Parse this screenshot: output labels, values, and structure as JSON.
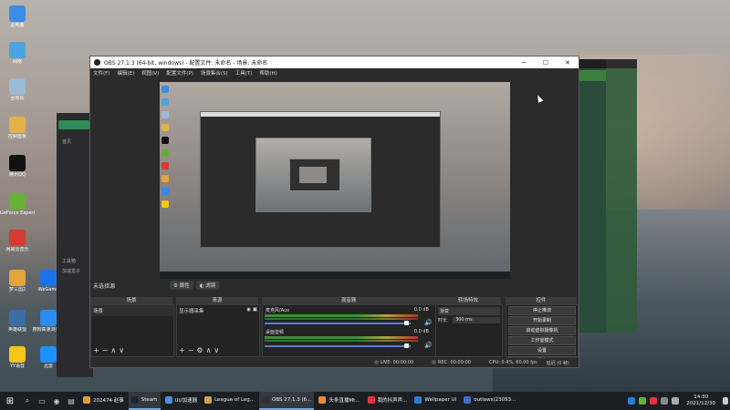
{
  "desktop": {
    "icons": [
      {
        "label": "此电脑",
        "color": "#3a8ee6"
      },
      {
        "label": "网络",
        "color": "#4aa3df"
      },
      {
        "label": "回收站",
        "color": "#9bbbd6"
      },
      {
        "label": "控制面板",
        "color": "#e0b34a"
      },
      {
        "label": "腾讯QQ",
        "color": "#111111"
      },
      {
        "label": "GeForce Experience",
        "color": "#66b032"
      },
      {
        "label": "网易云音乐",
        "color": "#d43c33"
      },
      {
        "label": "梦三国2",
        "color": "#e2a53c"
      },
      {
        "label": "WeGame",
        "color": "#1a73e8"
      },
      {
        "label": "英雄联盟",
        "color": "#3a6ea5"
      },
      {
        "label": "搜狗高速浏览器",
        "color": "#2d8cf0"
      },
      {
        "label": "YY语音",
        "color": "#f5c518"
      },
      {
        "label": "迅雷",
        "color": "#1e90ff"
      }
    ],
    "behind_app_labels": [
      "首页",
      "工具箱",
      "加速盒子"
    ]
  },
  "obs": {
    "title": "OBS 27.1.3 (64-bit, windows) - 配置文件: 未命名 - 场景: 未命名",
    "menu": [
      "文件(F)",
      "编辑(E)",
      "视图(V)",
      "配置文件(P)",
      "场景集合(S)",
      "工具(T)",
      "帮助(H)"
    ],
    "window_buttons": [
      "─",
      "☐",
      "✕"
    ],
    "source_bar": {
      "label": "未选择源",
      "props": "属性",
      "filters": "滤镜"
    },
    "panels": {
      "scenes": {
        "title": "场景",
        "items": [
          "场景"
        ]
      },
      "sources": {
        "title": "来源",
        "items": [
          "显示器采集"
        ]
      },
      "mixer": {
        "title": "混音器",
        "tracks": [
          {
            "name": "麦克风/Aux",
            "db": "0.0 dB"
          },
          {
            "name": "桌面音频",
            "db": "0.0 dB"
          }
        ]
      },
      "transitions": {
        "title": "转场特效",
        "type": "渐变",
        "duration_label": "时长",
        "duration": "300 ms"
      },
      "controls": {
        "title": "控件",
        "buttons": [
          "停止推流",
          "开始录制",
          "启动虚拟摄像机",
          "工作室模式",
          "设置",
          "退出"
        ]
      }
    },
    "statusbar": {
      "live": "LIVE: 00:00:00",
      "rec": "REC: 00:00:00",
      "cpu": "CPU: 0.4%, 60.00 fps",
      "msg": "延迟 (0 帧)"
    }
  },
  "taskbar": {
    "tasks": [
      {
        "label": "202474·赵事",
        "color": "#e0a030",
        "active": false
      },
      {
        "label": "Steam",
        "color": "#1b2838",
        "active": true
      },
      {
        "label": "UU加速器",
        "color": "#4a90e2",
        "active": false
      },
      {
        "label": "League of Leg...",
        "color": "#c8a545",
        "active": false
      },
      {
        "label": "OBS 27.1.3 (6...",
        "color": "#333333",
        "active": true
      },
      {
        "label": "头条直播Mt...",
        "color": "#f08a2d",
        "active": false
      },
      {
        "label": "我的抖声声...",
        "color": "#e6323c",
        "active": false
      },
      {
        "label": "Wallpaper UI",
        "color": "#2a7fd4",
        "active": false
      },
      {
        "label": "outlaws(23053...",
        "color": "#3f6ec5",
        "active": false
      }
    ],
    "time": "14:30",
    "date": "2021/12/30"
  }
}
